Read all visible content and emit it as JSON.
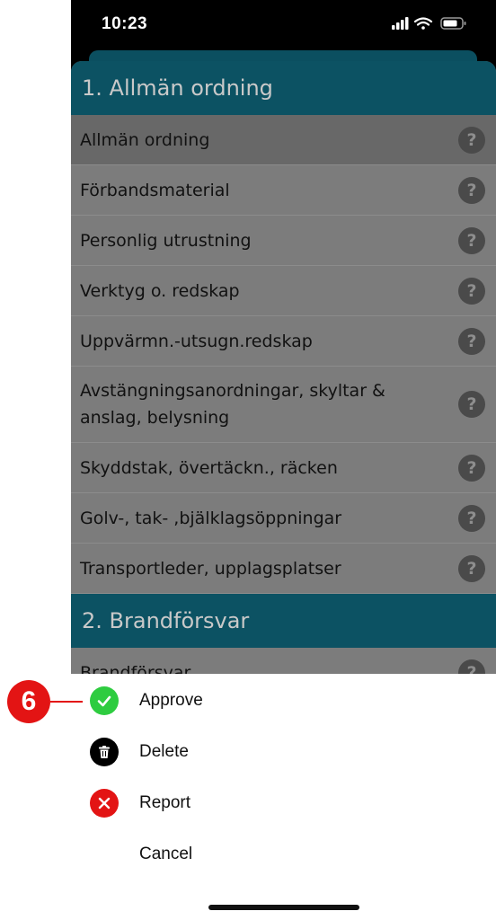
{
  "status": {
    "time": "10:23"
  },
  "sections": [
    {
      "title": "1. Allmän ordning",
      "items": [
        "Allmän ordning",
        "Förbandsmaterial",
        "Personlig utrustning",
        "Verktyg o. redskap",
        "Uppvärmn.-utsugn.redskap",
        "Avstängningsanordningar, skyltar & anslag, belysning",
        "Skyddstak, övertäckn., räcken",
        "Golv-, tak- ,bjälklagsöppningar",
        "Transportleder, upplagsplatser"
      ]
    },
    {
      "title": "2. Brandförsvar",
      "items": [
        "Brandförsvar"
      ]
    }
  ],
  "help_glyph": "?",
  "action_sheet": {
    "approve": "Approve",
    "delete": "Delete",
    "report": "Report",
    "cancel": "Cancel"
  },
  "annotation": {
    "step": "6"
  },
  "colors": {
    "header": "#0c5263",
    "approve": "#2ecc40",
    "report": "#e31414",
    "badge": "#e31414"
  }
}
